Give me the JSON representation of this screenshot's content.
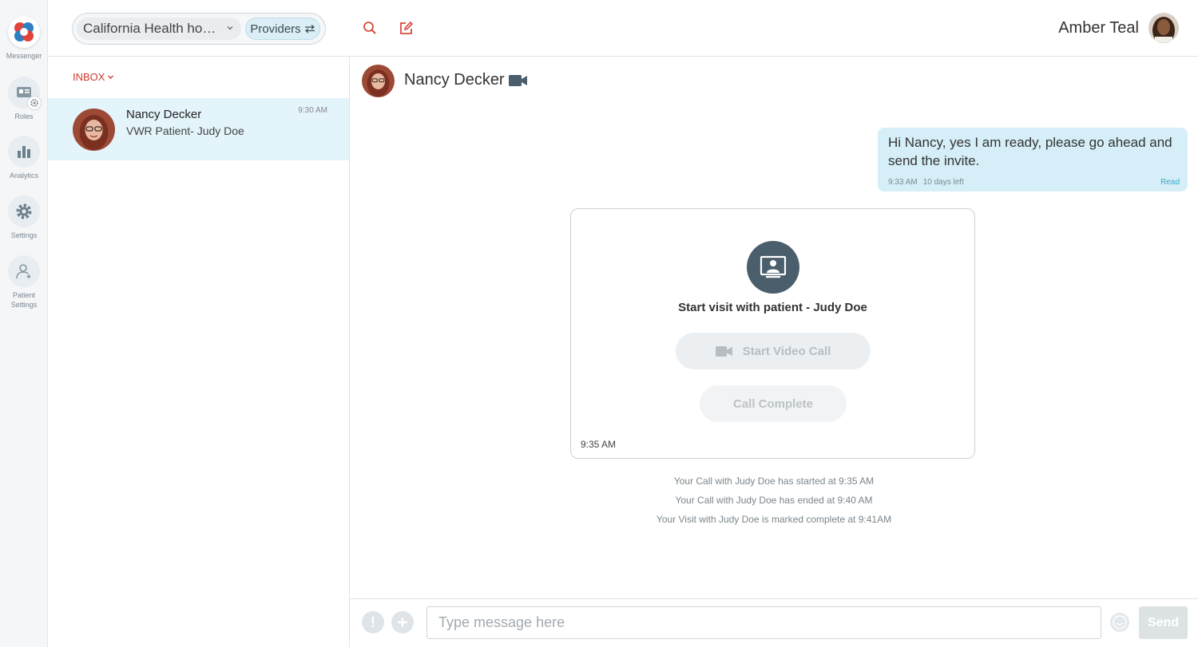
{
  "rail": {
    "items": [
      {
        "label": "Messenger"
      },
      {
        "label": "Roles"
      },
      {
        "label": "Analytics"
      },
      {
        "label": "Settings"
      },
      {
        "label": "Patient\nSettings",
        "line1": "Patient",
        "line2": "Settings"
      }
    ]
  },
  "topbar": {
    "org_selected": "California Health hospital",
    "providers_label": "Providers",
    "user_name": "Amber Teal"
  },
  "inbox": {
    "label": "INBOX",
    "conversations": [
      {
        "name": "Nancy Decker",
        "subtitle": "VWR Patient- Judy Doe",
        "time": "9:30 AM"
      }
    ]
  },
  "chat": {
    "contact_name": "Nancy Decker",
    "message": {
      "text": "Hi Nancy, yes I am ready, please go ahead and send the invite.",
      "time": "9:33 AM",
      "expiry": "10 days left",
      "status": "Read"
    },
    "visit_card": {
      "title": "Start visit with patient - Judy Doe",
      "start_call_label": "Start Video Call",
      "call_complete_label": "Call Complete",
      "time": "9:35 AM"
    },
    "system_messages": [
      "Your Call with Judy Doe has started at 9:35 AM",
      "Your Call with Judy Doe has ended at 9:40 AM",
      "Your Visit with Judy Doe is marked complete at 9:41AM"
    ]
  },
  "composer": {
    "placeholder": "Type message here",
    "send_label": "Send"
  },
  "colors": {
    "accent_red": "#cc3b2e",
    "selected_row": "#e4f4fb",
    "bubble": "#d5eef7",
    "read_status": "#3aa8c9",
    "visit_icon_bg": "#4a5e6c"
  }
}
